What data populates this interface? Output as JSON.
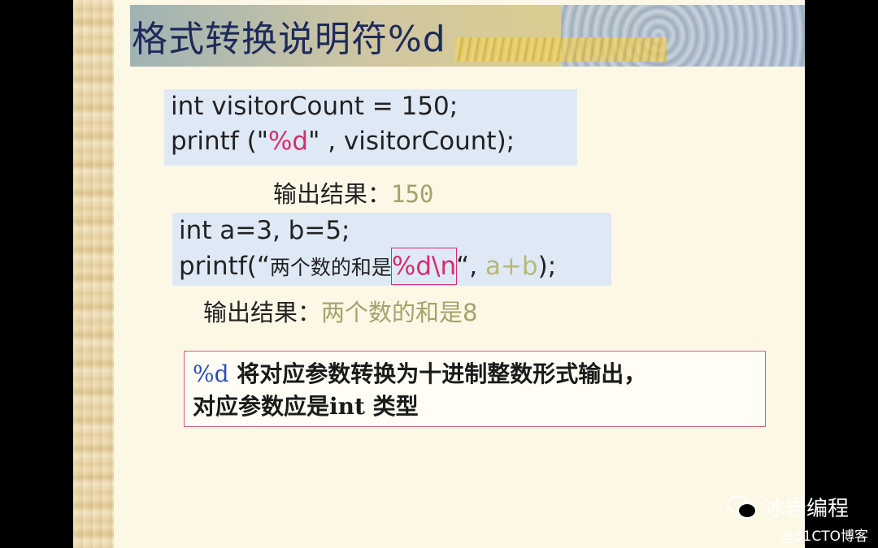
{
  "title": "格式转换说明符%d",
  "example1": {
    "line1": "int visitorCount = 150;",
    "line2_prefix": "printf (\"",
    "line2_spec": "%d",
    "line2_suffix": "\" , visitorCount);",
    "result_label": "输出结果：",
    "result_value": "150"
  },
  "example2": {
    "line1": "int a=3, b=5;",
    "line2_prefix": "printf(“",
    "line2_text": "两个数的和是",
    "line2_spec": "%d\\n",
    "line2_close": "“, ",
    "line2_arg": "a+b",
    "line2_end": ");",
    "result_label": "输出结果：",
    "result_value": "两个数的和是8"
  },
  "note": {
    "spec": "%d",
    "text1": " 将对应参数转换为十进制整数形式输出，",
    "text2": "对应参数应是int 类型"
  },
  "watermark": {
    "name": "冰岩编程",
    "blog": "@51CTO博客"
  },
  "colors": {
    "highlight": "#d62c6e",
    "result": "#a3a36a",
    "title": "#1d2a5a",
    "code_bg": "#dfe9f6"
  }
}
